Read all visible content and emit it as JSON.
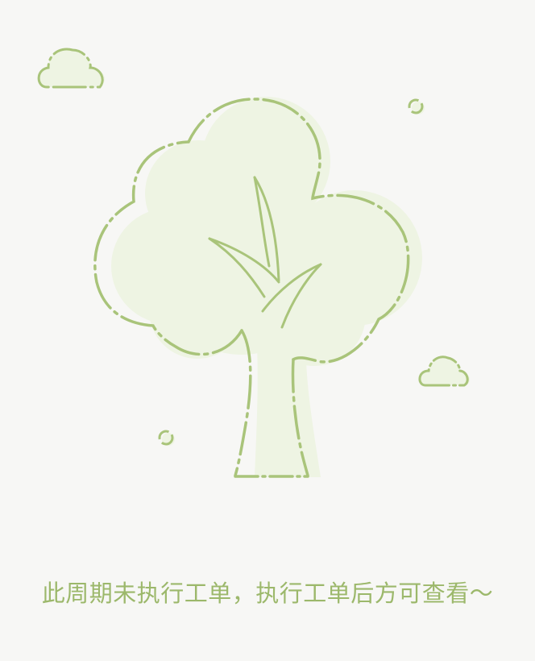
{
  "empty_state": {
    "illustration_icon": "tree-icon",
    "message": "此周期未执行工单，执行工单后方可查看～"
  },
  "colors": {
    "background": "#f7f7f5",
    "fill": "#eef4e3",
    "stroke": "#a9c47a",
    "text": "#9cb86b"
  }
}
